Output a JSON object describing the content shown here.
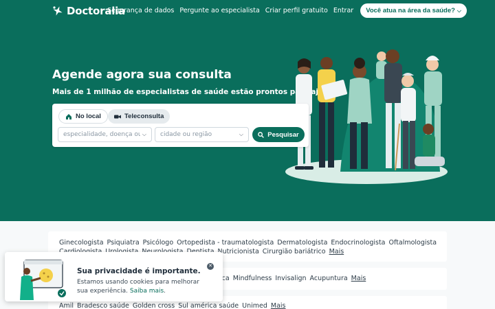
{
  "brand": {
    "name": "Doctoralia",
    "color": "#0a6e5c"
  },
  "nav": {
    "links": [
      "Segurança de dados",
      "Pergunte ao especialista",
      "Criar perfil gratuito",
      "Entrar"
    ],
    "cta": "Você atua na área da saúde?"
  },
  "hero": {
    "title": "Agende agora sua consulta",
    "subtitle": "Mais de 1 milhão de especialistas de saúde estão prontos para ajudar"
  },
  "search": {
    "tabs": {
      "local": "No local",
      "tele": "Teleconsulta"
    },
    "specialty_placeholder": "especialidade, doença ou nome",
    "city_placeholder": "cidade ou região",
    "button": "Pesquisar"
  },
  "specialties": {
    "items": [
      "Ginecologista",
      "Psiquiatra",
      "Psicólogo",
      "Ortopedista - traumatologista",
      "Dermatologista",
      "Endocrinologista",
      "Oftalmologista",
      "Cardiologista",
      "Urologista",
      "Neurologista",
      "Dentista",
      "Nutricionista",
      "Cirurgião bariátrico"
    ],
    "more": "Mais"
  },
  "treatments": {
    "items": [
      "ica",
      "Mindfulness",
      "Invisalign",
      "Acupuntura"
    ],
    "more": "Mais"
  },
  "insurers": {
    "items": [
      "Amil",
      "Bradesco saúde",
      "Golden cross",
      "Sul américa saúde",
      "Unimed"
    ],
    "more": "Mais"
  },
  "cookie": {
    "title": "Sua privacidade é importante.",
    "text": "Estamos usando cookies para melhorar sua experiência.",
    "link": "Saiba mais",
    "link_suffix": "."
  }
}
